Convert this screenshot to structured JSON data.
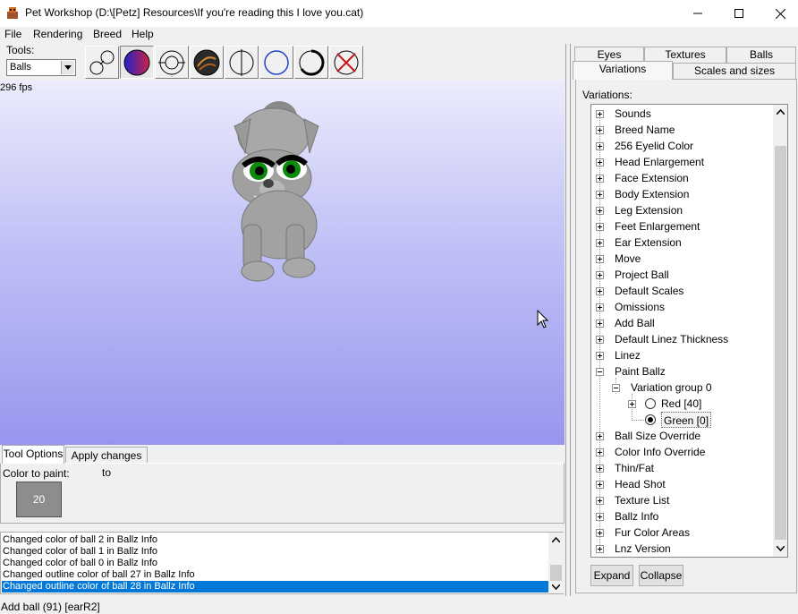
{
  "window": {
    "title": "Pet Workshop (D:\\[Petz] Resources\\If you're reading this I love you.cat)",
    "app_icon": "pet-workshop-icon",
    "controls": [
      "minimize-icon",
      "maximize-icon",
      "close-icon"
    ]
  },
  "menu": {
    "items": [
      "File",
      "Rendering",
      "Breed",
      "Help"
    ]
  },
  "tools": {
    "label": "Tools:",
    "selected": "Balls",
    "buttons": [
      {
        "icon": "balls-connect-icon",
        "pressed": false
      },
      {
        "icon": "color-ball-icon",
        "pressed": true
      },
      {
        "icon": "resize-ball-icon",
        "pressed": false
      },
      {
        "icon": "texture-ball-icon",
        "pressed": false
      },
      {
        "icon": "split-ball-icon",
        "pressed": false
      },
      {
        "icon": "outline-circle-icon",
        "pressed": false
      },
      {
        "icon": "thick-outline-icon",
        "pressed": false
      },
      {
        "icon": "delete-ball-icon",
        "pressed": false
      }
    ]
  },
  "viewport": {
    "fps": "296 fps"
  },
  "bottom_tabs": [
    "Tool Options",
    "Apply changes to"
  ],
  "tool_options": {
    "color_label": "Color to paint:",
    "color_value": "20"
  },
  "log": {
    "lines": [
      "Changed color of ball 2 in Ballz Info",
      "Changed color of ball 1 in Ballz Info",
      "Changed color of ball 0 in Ballz Info",
      "Changed outline color of ball 27 in Ballz Info",
      "Changed outline color of ball 28 in Ballz Info"
    ],
    "selected_index": 4
  },
  "status": "Add ball (91) [earR2]",
  "right_tabs": {
    "row1": [
      "Eyes",
      "Textures",
      "Balls"
    ],
    "row2": [
      "Variations",
      "Scales and sizes"
    ],
    "active": "Variations"
  },
  "variations": {
    "label": "Variations:",
    "items": [
      "Sounds",
      "Breed Name",
      "256 Eyelid Color",
      "Head Enlargement",
      "Face Extension",
      "Body Extension",
      "Leg Extension",
      "Feet Enlargement",
      "Ear Extension",
      "Move",
      "Project Ball",
      "Default Scales",
      "Omissions",
      "Add Ball",
      "Default Linez Thickness",
      "Linez",
      "Paint Ballz"
    ],
    "group": "Variation group 0",
    "options": [
      {
        "label": "Red [40]",
        "checked": false
      },
      {
        "label": "Green [0]",
        "checked": true
      }
    ],
    "items_after": [
      "Ball Size Override",
      "Color Info Override",
      "Thin/Fat",
      "Head Shot",
      "Texture List",
      "Ballz Info",
      "Fur Color Areas",
      "Lnz Version"
    ]
  },
  "buttons": {
    "expand": "Expand",
    "collapse": "Collapse"
  },
  "colors": {
    "selection": "#0078d7",
    "viewport_top": "#ececfd",
    "viewport_bottom": "#9696ef",
    "swatch": "#8d8d8d"
  }
}
